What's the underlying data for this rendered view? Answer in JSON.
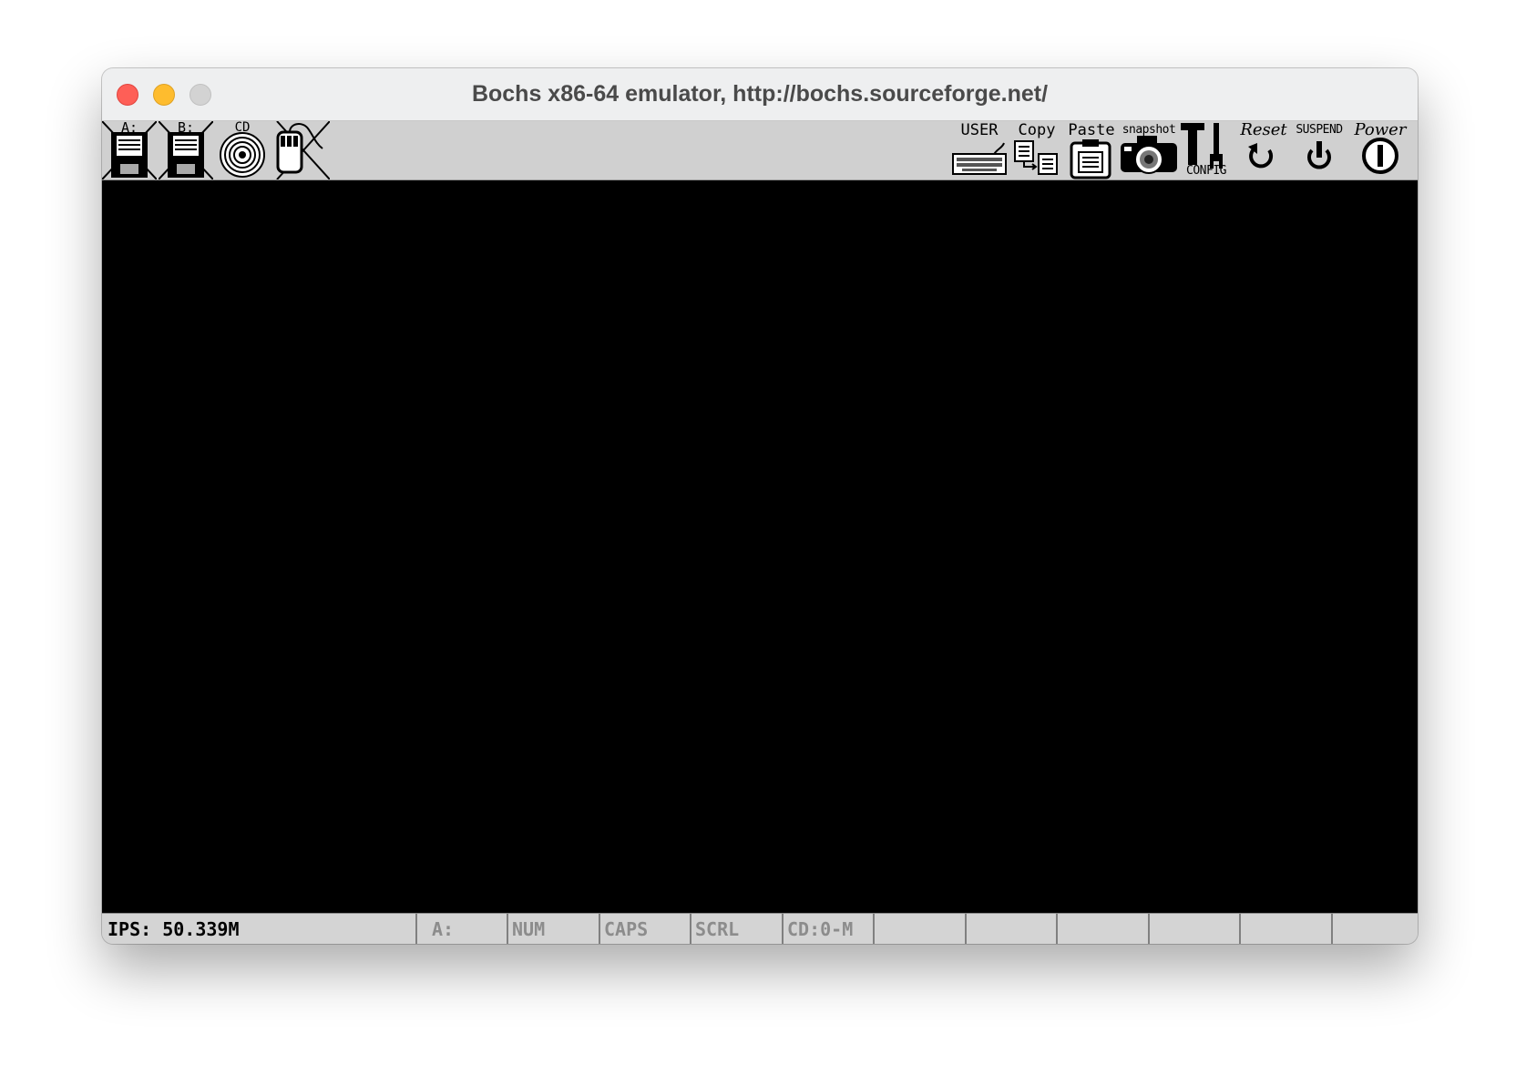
{
  "window": {
    "title": "Bochs x86-64 emulator, http://bochs.sourceforge.net/"
  },
  "toolbar": {
    "left": [
      {
        "id": "floppy-a",
        "label": "A:",
        "icon": "floppy-disk-icon"
      },
      {
        "id": "floppy-b",
        "label": "B:",
        "icon": "floppy-disk-icon"
      },
      {
        "id": "cdrom",
        "label": "CD",
        "icon": "cdrom-icon"
      },
      {
        "id": "mouse",
        "label": "",
        "icon": "mouse-icon"
      }
    ],
    "right": [
      {
        "id": "user",
        "label": "USER",
        "icon": "keyboard-icon"
      },
      {
        "id": "copy",
        "label": "Copy",
        "icon": "copy-icon"
      },
      {
        "id": "paste",
        "label": "Paste",
        "icon": "clipboard-icon"
      },
      {
        "id": "snapshot",
        "label": "snapshot",
        "icon": "camera-icon"
      },
      {
        "id": "config",
        "label": "CONFIG",
        "icon": "tools-icon"
      },
      {
        "id": "reset",
        "label": "Reset",
        "icon": "reset-icon"
      },
      {
        "id": "suspend",
        "label": "SUSPEND",
        "icon": "suspend-icon"
      },
      {
        "id": "power",
        "label": "Power",
        "icon": "power-icon"
      }
    ]
  },
  "statusbar": {
    "ips": "IPS: 50.339M",
    "cells": [
      "A:",
      "NUM",
      "CAPS",
      "SCRL",
      "CD:0-M",
      "",
      "",
      "",
      "",
      "",
      ""
    ]
  }
}
